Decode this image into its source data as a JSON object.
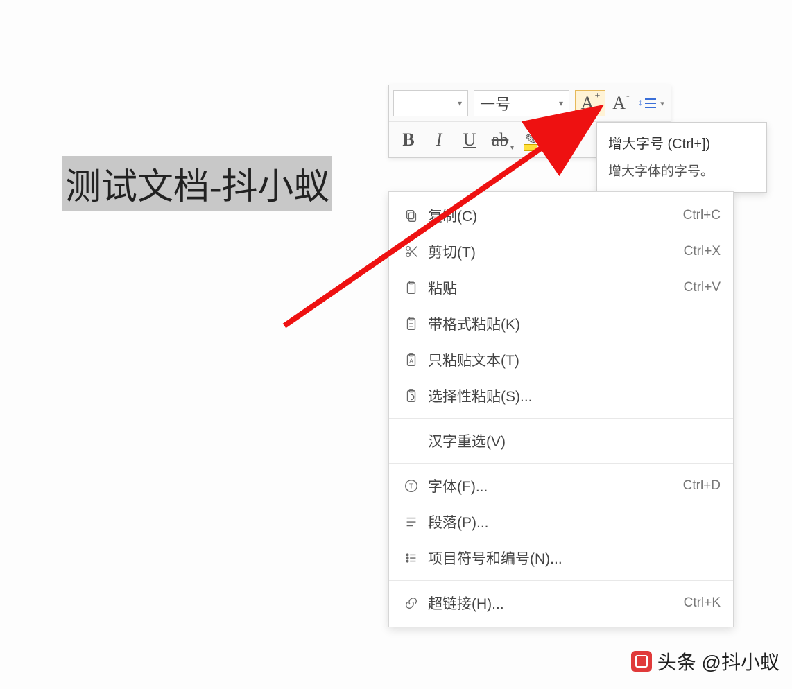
{
  "document": {
    "selected_text": "测试文档-抖小蚁"
  },
  "toolbar": {
    "font_name": "",
    "font_size": "一号",
    "increase_font_glyph": "A",
    "increase_font_sup": "+",
    "decrease_font_glyph": "A",
    "decrease_font_sup": "-",
    "bold": "B",
    "italic": "I",
    "underline": "U",
    "strike": "ab"
  },
  "tooltip": {
    "title": "增大字号 (Ctrl+])",
    "description": "增大字体的字号。"
  },
  "context_menu": {
    "items": [
      {
        "icon": "copy",
        "label": "复制(C)",
        "shortcut": "Ctrl+C"
      },
      {
        "icon": "cut",
        "label": "剪切(T)",
        "shortcut": "Ctrl+X"
      },
      {
        "icon": "paste",
        "label": "粘贴",
        "shortcut": "Ctrl+V"
      },
      {
        "icon": "paste-fmt",
        "label": "带格式粘贴(K)",
        "shortcut": ""
      },
      {
        "icon": "paste-text",
        "label": "只粘贴文本(T)",
        "shortcut": ""
      },
      {
        "icon": "paste-sp",
        "label": "选择性粘贴(S)...",
        "shortcut": ""
      },
      {
        "icon": "",
        "label": "汉字重选(V)",
        "shortcut": ""
      },
      {
        "icon": "font-t",
        "label": "字体(F)...",
        "shortcut": "Ctrl+D"
      },
      {
        "icon": "paragraph",
        "label": "段落(P)...",
        "shortcut": ""
      },
      {
        "icon": "bullets",
        "label": "项目符号和编号(N)...",
        "shortcut": ""
      },
      {
        "icon": "link",
        "label": "超链接(H)...",
        "shortcut": "Ctrl+K"
      }
    ]
  },
  "watermark": {
    "text": "头条 @抖小蚁"
  }
}
